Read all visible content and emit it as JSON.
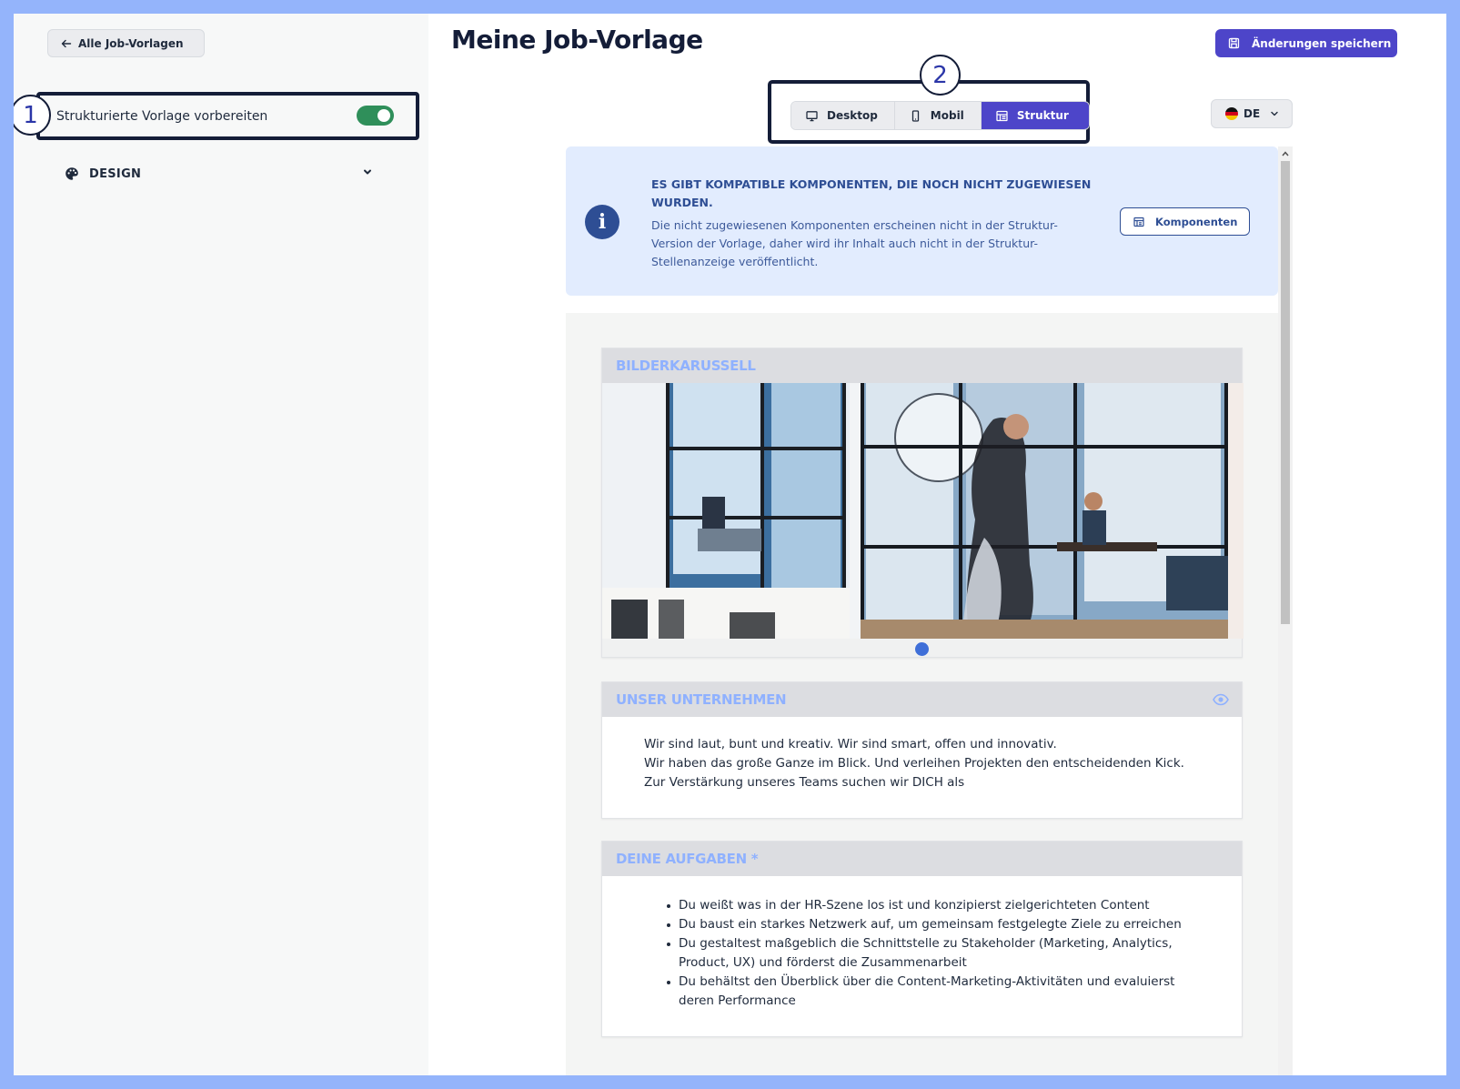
{
  "sidebar": {
    "back_label": "Alle Job-Vorlagen",
    "toggle_label": "Strukturierte Vorlage vorbereiten",
    "toggle_on": true,
    "design_label": "DESIGN"
  },
  "markers": {
    "one": "1",
    "two": "2"
  },
  "header": {
    "title": "Meine Job-Vorlage",
    "save_label": "Änderungen speichern"
  },
  "views": {
    "desktop": "Desktop",
    "mobile": "Mobil",
    "structure": "Struktur",
    "active": "Struktur"
  },
  "language": {
    "selected": "DE"
  },
  "info": {
    "title": "Es gibt kompatible Komponenten, die noch nicht zugewiesen wurden.",
    "text": "Die nicht zugewiesenen Komponenten erscheinen nicht in der Struktur-Version der Vorlage, daher wird ihr Inhalt auch nicht in der Struktur-Stellenanzeige veröffentlicht.",
    "button_label": "Komponenten"
  },
  "sections": {
    "carousel": {
      "title": "BILDERKARUSSELL"
    },
    "company": {
      "title": "UNSER UNTERNEHMEN",
      "lines": [
        "Wir sind laut, bunt und kreativ. Wir sind smart, offen und innovativ.",
        "Wir haben das große Ganze im Blick. Und verleihen Projekten den entscheidenden Kick.",
        "Zur Verstärkung unseres Teams suchen wir DICH als"
      ]
    },
    "tasks": {
      "title": "DEINE AUFGABEN *",
      "items": [
        "Du weißt was in der HR-Szene los ist und konzipierst zielgerichteten Content",
        "Du baust ein starkes Netzwerk auf, um gemeinsam festgelegte Ziele zu erreichen",
        "Du gestaltest maßgeblich die Schnittstelle zu Stakeholder (Marketing, Analytics, Product, UX) und förderst die Zusammenarbeit",
        "Du behältst den Überblick über die Content-Marketing-Aktivitäten und evaluierst deren Performance"
      ]
    }
  },
  "colors": {
    "accent": "#4d45c9",
    "annotation_border": "#141d38",
    "toggle_on": "#2f8f5a",
    "info_bg": "#e2ecfe",
    "info_text": "#2e4e94",
    "section_title": "#8fb1ff"
  }
}
